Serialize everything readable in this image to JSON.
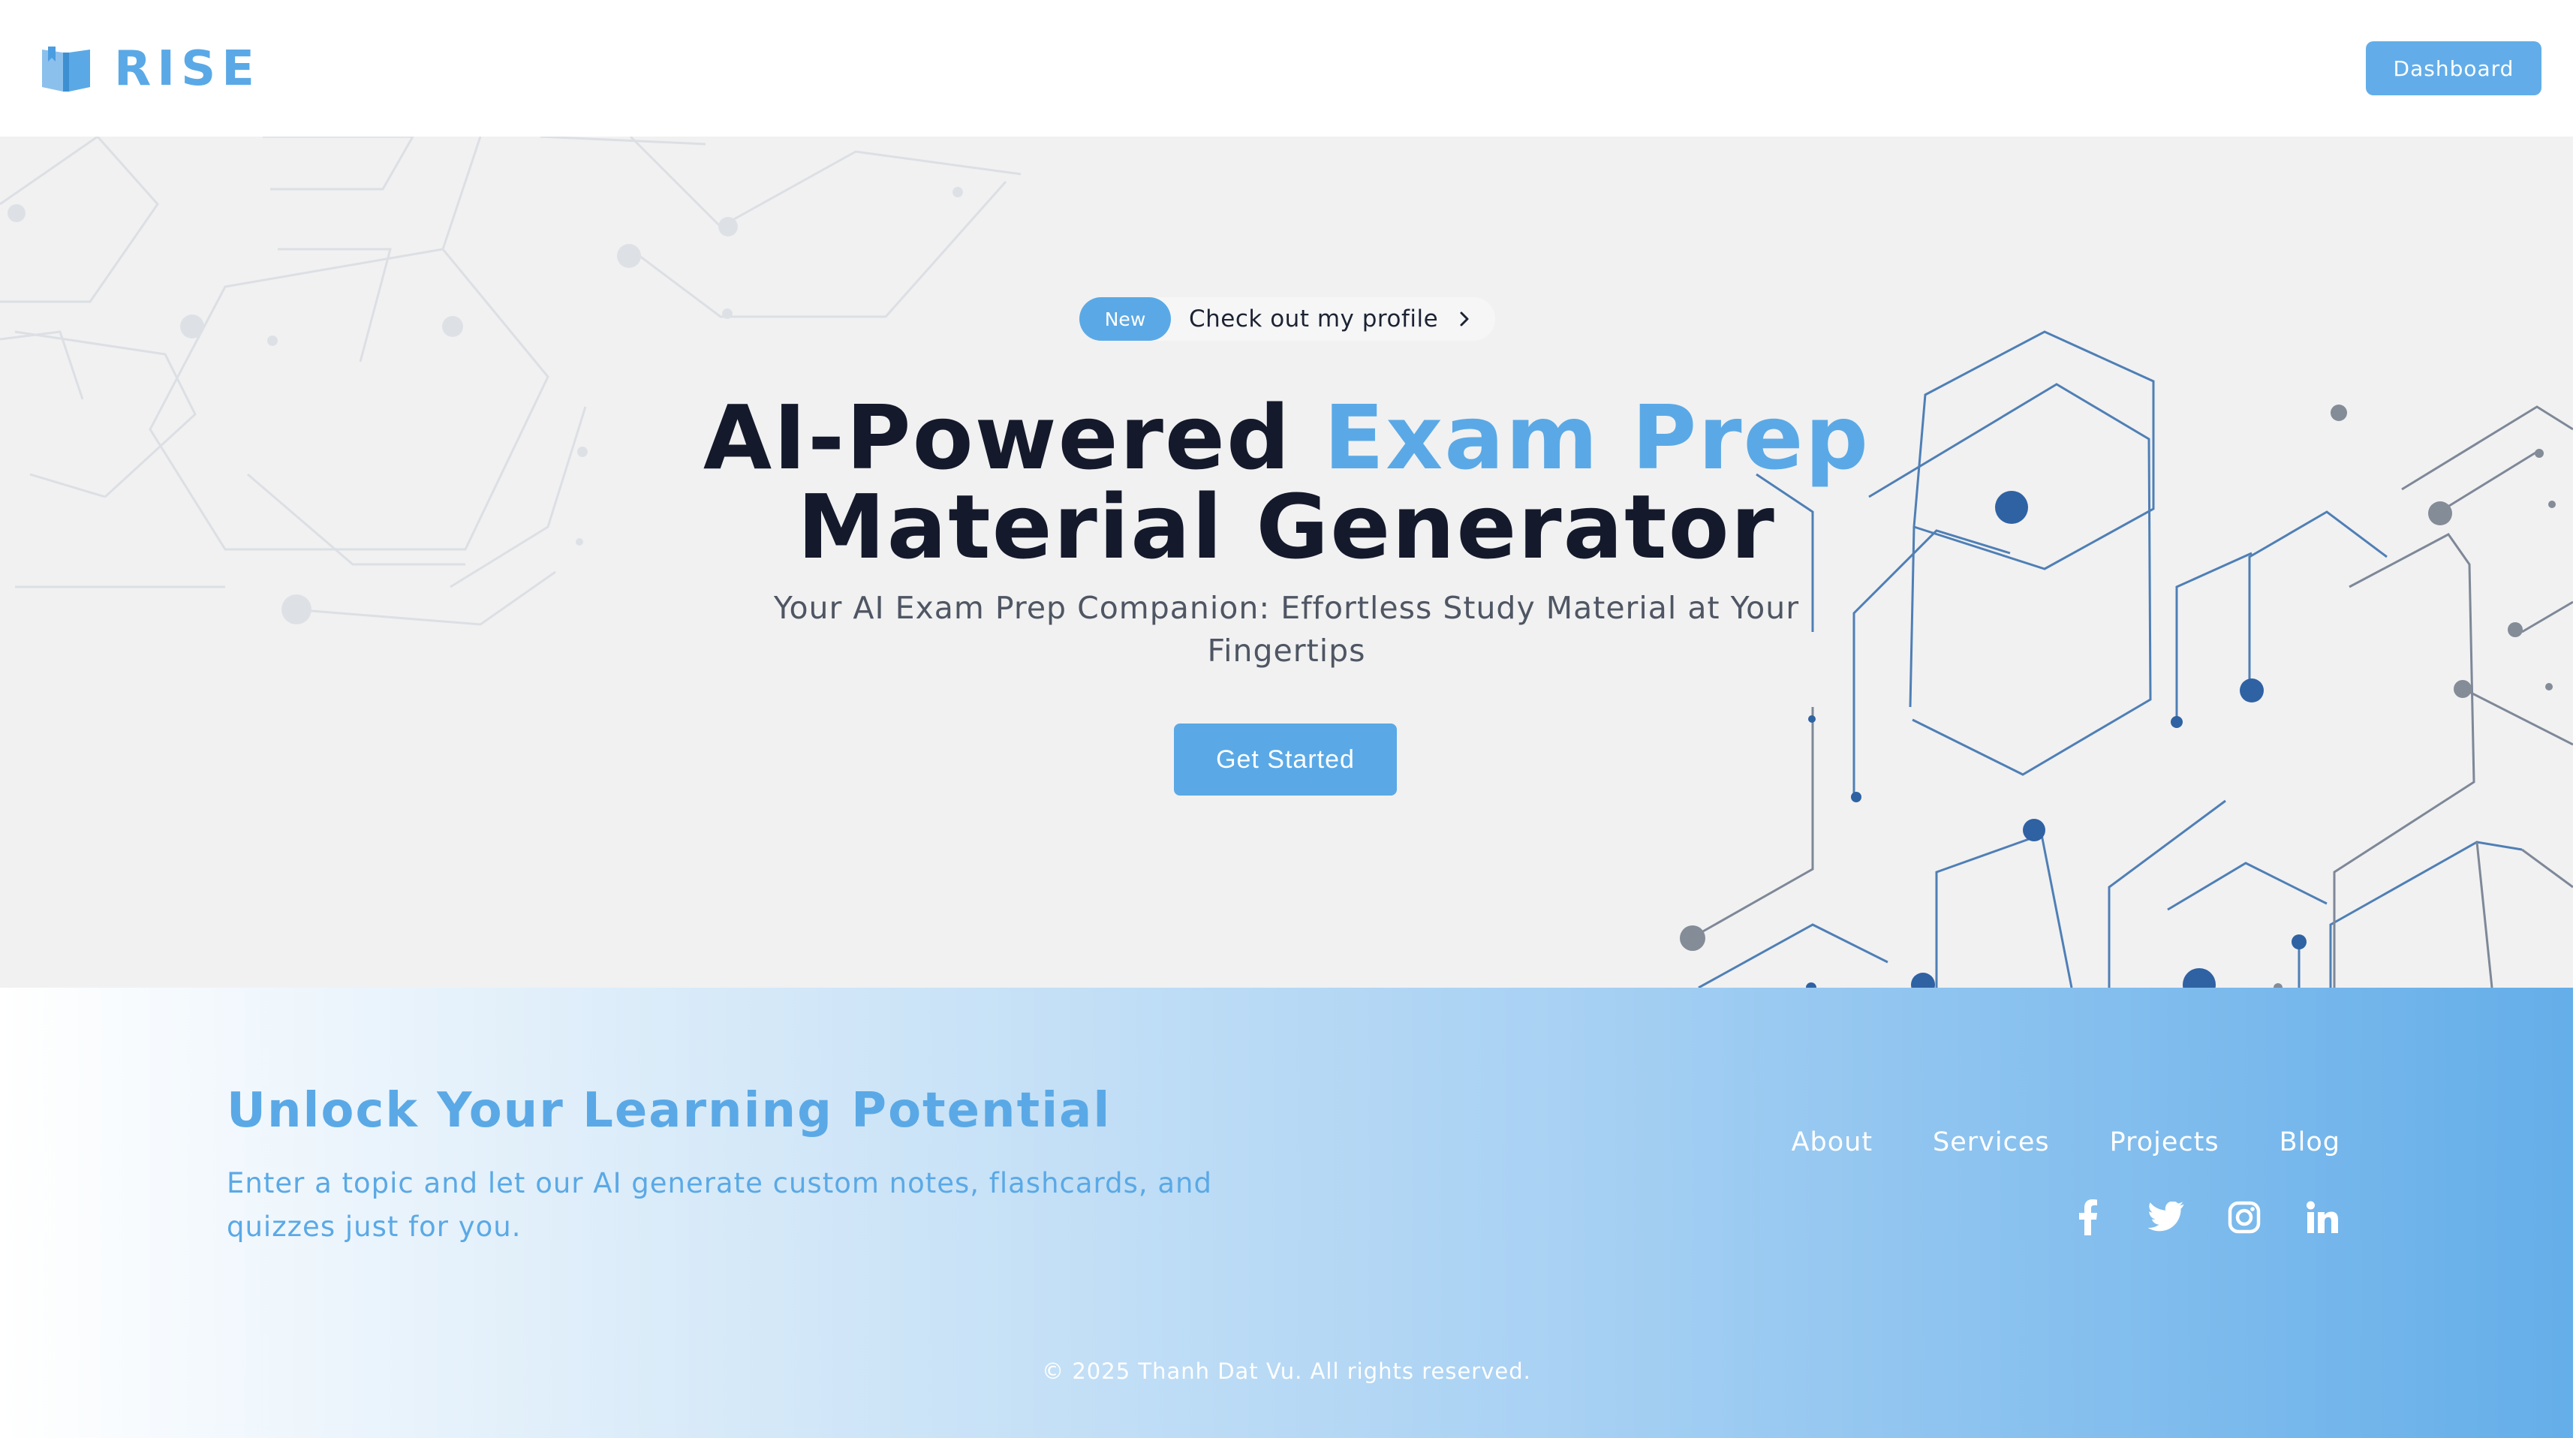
{
  "header": {
    "brand_name": "RISE",
    "brand_icon": "book-icon",
    "dashboard_label": "Dashboard"
  },
  "hero": {
    "badge_label": "New",
    "badge_text": "Check out my profile",
    "title_part1": "AI-Powered ",
    "title_accent": "Exam Prep",
    "title_line2": "Material Generator",
    "subtitle": "Your AI Exam Prep Companion: Effortless Study Material at Your Fingertips",
    "cta_label": "Get Started"
  },
  "footer": {
    "title": "Unlock Your Learning Potential",
    "description": "Enter a topic and let our AI generate custom notes, flashcards, and quizzes just for you.",
    "nav": [
      "About",
      "Services",
      "Projects",
      "Blog"
    ],
    "social": [
      "facebook-icon",
      "twitter-icon",
      "instagram-icon",
      "linkedin-icon"
    ],
    "copyright": "© 2025 Thanh Dat Vu. All rights reserved."
  },
  "colors": {
    "accent": "#5aa9e6",
    "heading": "#141a2b",
    "hero_bg": "#f1f1f2",
    "footer_end": "#64aee9"
  }
}
